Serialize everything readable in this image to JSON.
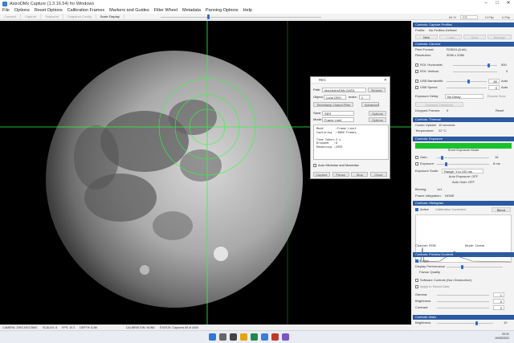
{
  "window": {
    "title": "AstroDMx Capture (1.3.16.54) for Windows",
    "controls": [
      "–",
      "□",
      "✕"
    ]
  },
  "menu": [
    "File",
    "Options",
    "Reset Options",
    "Calibration Frames",
    "Markers and Guides",
    "Filter Wheel",
    "Metadata",
    "Panning Options",
    "Help"
  ],
  "toolbar": {
    "connect": "Connect",
    "capture": "Capture",
    "snapshot": "Snapshot",
    "snapshot_config": "Snapshot Config",
    "scale_display": "Scale Display",
    "scale_value": "64 %",
    "fit": "FIT",
    "h_flip": "H-Flip",
    "v_flip": "V-Flip"
  },
  "status_bar": {
    "camera": "CAMERA: ZWO ASI178MC",
    "scales": "SCALES: 8",
    "fps": "FPS: 10.3",
    "depth": "DEPTH: 8-Bit",
    "calibration": "CALIBRATION: NONE",
    "status": "STATUS: Captured 65 of 4000"
  },
  "capture_dialog": {
    "title": "REC",
    "close_icon": "✕",
    "path_label": "Path:",
    "path_value": "ktop\\AstroDMx DATA",
    "browse": "Browse",
    "object_label": "Object:",
    "object_value": "Luna DRO",
    "index_label": "Index:",
    "index_value": "1",
    "timestamp_folder": "Timestamp Output Files",
    "advanced": "Advanced",
    "save_label": "Save:",
    "save_value": "SER",
    "save_options": "Options",
    "mode_label": "Mode:",
    "mode_value": "Frame Limit",
    "mode_options": "Options",
    "log_lines": [
      "Mode       :Frame Limit",
      "Capturing  :3000 Frames",
      "",
      "Time Taken:3 s",
      "Dropped   :0",
      "Remaining :2935"
    ],
    "auto_minimise": "Auto Minimise and Maximise",
    "buttons": [
      "Capture",
      "Pause",
      "Stop",
      "Close"
    ]
  },
  "panel": {
    "capture_profiles": {
      "header": "Controls: Capture Profiles",
      "profile_label": "Profile:",
      "profile_value": "No Profiles Defined",
      "buttons": [
        "New",
        "Load",
        "Save",
        "Manage"
      ]
    },
    "camera": {
      "header": "Controls: Camera",
      "pixel_format_label": "Pixel Format:",
      "pixel_format_value": "RGB24 (8-bit)",
      "resolution_label": "Resolution:",
      "resolution_value": "3096 x 2080",
      "roi_h_label": "ROI: Horizontal:",
      "roi_h_value": "500",
      "roi_v_label": "ROI: Vertical:",
      "roi_v_value": "0",
      "usb_bw_label": "USB Bandwidth:",
      "usb_bw_value": "80",
      "usb_bw_auto": "Auto",
      "usb_speed_label": "USB Speed:",
      "usb_speed_value": "0",
      "usb_speed_auto": "Auto",
      "exp_delay_label": "Exposure Delay:",
      "exp_delay_value": "No Delay",
      "exp_now": "Expose Now",
      "dropped_transform": "Dropped Transform",
      "dropped_frames_label": "Dropped Frames:",
      "dropped_frames_value": "0",
      "reset": "Reset"
    },
    "thermal": {
      "header": "Controls: Thermal",
      "cooler_label": "Cooler Update:",
      "cooler_value": "10 seconds",
      "temp_label": "Temperature:",
      "temp_value": "22 °C"
    },
    "exposure": {
      "header": "Controls: Exposure",
      "mode_button": "Short Exposure Mode",
      "gain_label": "Gain:",
      "gain_value": "16",
      "exposure_label": "Exposure:",
      "exposure_value": "8 ms",
      "scale_label": "Exposure Scale:",
      "scale_value": "Range: 1 to 100 ms",
      "auto_exposure": "Auto Exposure: OFF",
      "auto_gain": "Auto Gain: OFF",
      "binning_label": "Binning:",
      "binning_value": "1x1",
      "integration_label": "Frame Integration:",
      "integration_value": "NONE"
    },
    "histogram": {
      "header": "Controls: Histogram",
      "active": "Active",
      "calibration": "Calibration Corrected",
      "blend": "Blend",
      "channel_label": "Channel:",
      "channel_value": "RGB",
      "mode_label": "Mode:",
      "mode_value": "Linear"
    },
    "preview": {
      "header": "Controls: Preview Controls",
      "active": "Active",
      "display_perf": "Display Performance",
      "favour_quality": "Favour Quality",
      "software_controls": "Software Controls (Non Destructive)",
      "apply_saved": "Apply to Saved Data",
      "gamma_label": "Gamma:",
      "gamma_value": "1",
      "brightness_label": "Brightness:",
      "brightness_value": "0",
      "contrast_label": "Contrast:",
      "contrast_value": "0"
    },
    "main": {
      "header": "Controls: Main",
      "brightness_label": "Brightness:",
      "brightness_value": "10"
    }
  },
  "clock": {
    "time": "20:31",
    "date": "19/05/2022"
  },
  "colors": {
    "accent": "#2c5aa0",
    "green": "#17c22a",
    "reticle": "#2aff3a"
  }
}
